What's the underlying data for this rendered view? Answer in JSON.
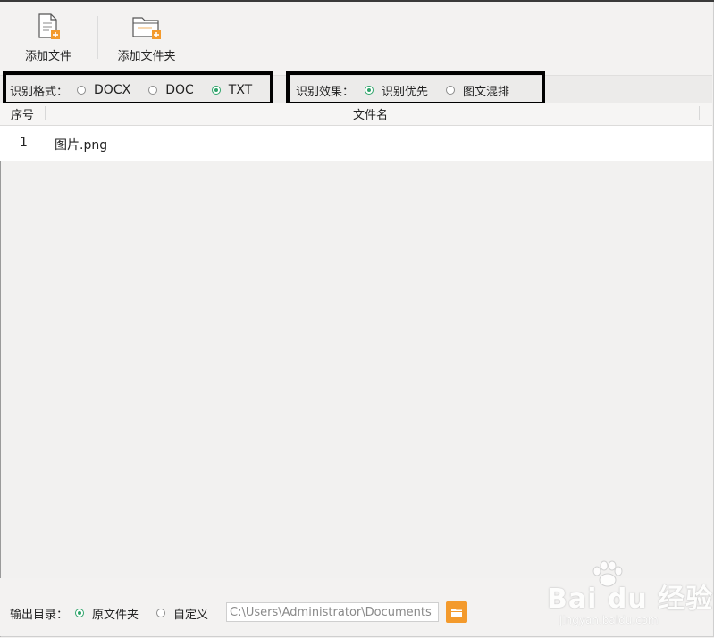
{
  "toolbar": {
    "add_file_label": "添加文件",
    "add_folder_label": "添加文件夹"
  },
  "format_group": {
    "label": "识别格式：",
    "options": [
      "DOCX",
      "DOC",
      "TXT"
    ],
    "selected": "TXT"
  },
  "effect_group": {
    "label": "识别效果：",
    "options": [
      "识别优先",
      "图文混排"
    ],
    "selected": "识别优先"
  },
  "table": {
    "columns": [
      "序号",
      "文件名"
    ],
    "rows": [
      {
        "index": "1",
        "filename": "图片.png"
      }
    ]
  },
  "output": {
    "label": "输出目录：",
    "options": [
      "原文件夹",
      "自定义"
    ],
    "selected": "原文件夹",
    "path_value": "C:\\Users\\Administrator\\Documents"
  },
  "watermark": {
    "text": "Bai du 经验",
    "sub": "jingyan.baidu.com"
  },
  "colors": {
    "accent_green": "#2fa46a",
    "folder_orange": "#f39a2c"
  }
}
